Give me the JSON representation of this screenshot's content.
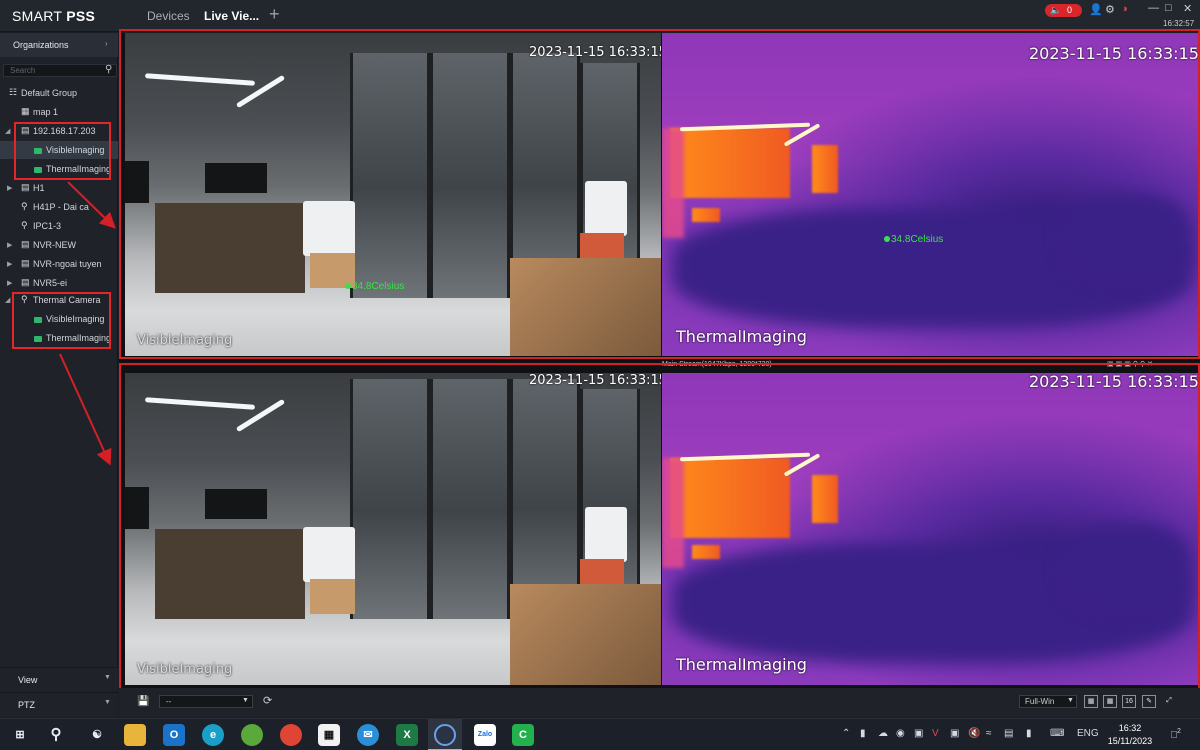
{
  "app": {
    "brand_normal": "SMART ",
    "brand_bold": "PSS",
    "tabs": [
      {
        "label": "Devices",
        "active": false
      },
      {
        "label": "Live Vie...",
        "active": true
      }
    ],
    "add_tab_icon": "plus-icon",
    "alarm_count": "0",
    "clock": "16:32:57",
    "window_controls": [
      "minimize-icon",
      "maximize-icon",
      "close-icon"
    ]
  },
  "sidebar": {
    "header": "Organizations",
    "search_placeholder": "Search",
    "tree": [
      {
        "label": "Default Group",
        "icon": "group-icon",
        "level": 0,
        "arrow": "",
        "selected": false
      },
      {
        "label": "map 1",
        "icon": "map-icon",
        "level": 1,
        "arrow": "",
        "selected": false
      },
      {
        "label": "192.168.17.203",
        "icon": "nvr-icon",
        "level": 0,
        "arrow": "expanded",
        "selected": false
      },
      {
        "label": "VisibleImaging",
        "icon": "camera-icon",
        "level": 2,
        "arrow": "",
        "selected": true
      },
      {
        "label": "ThermalImaging",
        "icon": "camera-icon",
        "level": 2,
        "arrow": "",
        "selected": false
      },
      {
        "label": "H1",
        "icon": "nvr-icon",
        "level": 0,
        "arrow": "collapsed",
        "selected": false
      },
      {
        "label": "H41P - Dai ca",
        "icon": "ipc-icon",
        "level": 1,
        "arrow": "",
        "selected": false
      },
      {
        "label": "IPC1-3",
        "icon": "ipc-icon",
        "level": 1,
        "arrow": "",
        "selected": false
      },
      {
        "label": "NVR-NEW",
        "icon": "nvr-icon",
        "level": 0,
        "arrow": "collapsed",
        "selected": false
      },
      {
        "label": "NVR-ngoai tuyen",
        "icon": "nvr-icon",
        "level": 0,
        "arrow": "collapsed",
        "selected": false
      },
      {
        "label": "NVR5-ei",
        "icon": "nvr-icon",
        "level": 0,
        "arrow": "collapsed",
        "selected": false
      },
      {
        "label": "Thermal Camera",
        "icon": "ipc-icon",
        "level": 0,
        "arrow": "expanded",
        "selected": false
      },
      {
        "label": "VisibleImaging",
        "icon": "camera-icon",
        "level": 2,
        "arrow": "",
        "selected": false
      },
      {
        "label": "ThermalImaging",
        "icon": "camera-icon",
        "level": 2,
        "arrow": "",
        "selected": false
      }
    ],
    "bottom_panels": [
      "View",
      "PTZ"
    ]
  },
  "views": {
    "top_visible": {
      "timestamp": "2023-11-15 16:33:15",
      "channel": "VisibleImaging",
      "temperature": "34.8Celsius"
    },
    "top_thermal": {
      "timestamp": "2023-11-15 16:33:15",
      "channel": "ThermalImaging",
      "temperature": "34.8Celsius"
    },
    "bottom_visible": {
      "timestamp": "2023-11-15 16:33:15",
      "channel": "VisibleImaging"
    },
    "bottom_thermal": {
      "timestamp": "2023-11-15 16:33:15",
      "channel": "ThermalImaging",
      "stream_info": "Main Stream(1047Kbps, 1280*720)"
    }
  },
  "controls": {
    "view_select": "--",
    "window_mode": "Full-Win",
    "layout_buttons": [
      "layout-2x2-icon",
      "layout-3x3-icon",
      "16",
      "custom-layout-icon",
      "fullscreen-icon"
    ]
  },
  "taskbar": {
    "apps": [
      "start-icon",
      "search-icon",
      "task-view-icon",
      "file-explorer-icon",
      "outlook-icon",
      "edge-icon",
      "chrome-ext-icon",
      "chrome-icon",
      "qr-icon",
      "mail-icon",
      "excel-icon",
      "smartpss-icon",
      "zalo-icon",
      "green-app-icon"
    ],
    "zalo_label": "Zalo",
    "excel_label": "X",
    "tray_language": "ENG",
    "time": "16:32",
    "date": "15/11/2023",
    "notification_count": "2"
  },
  "annotation_color": "#d42027"
}
